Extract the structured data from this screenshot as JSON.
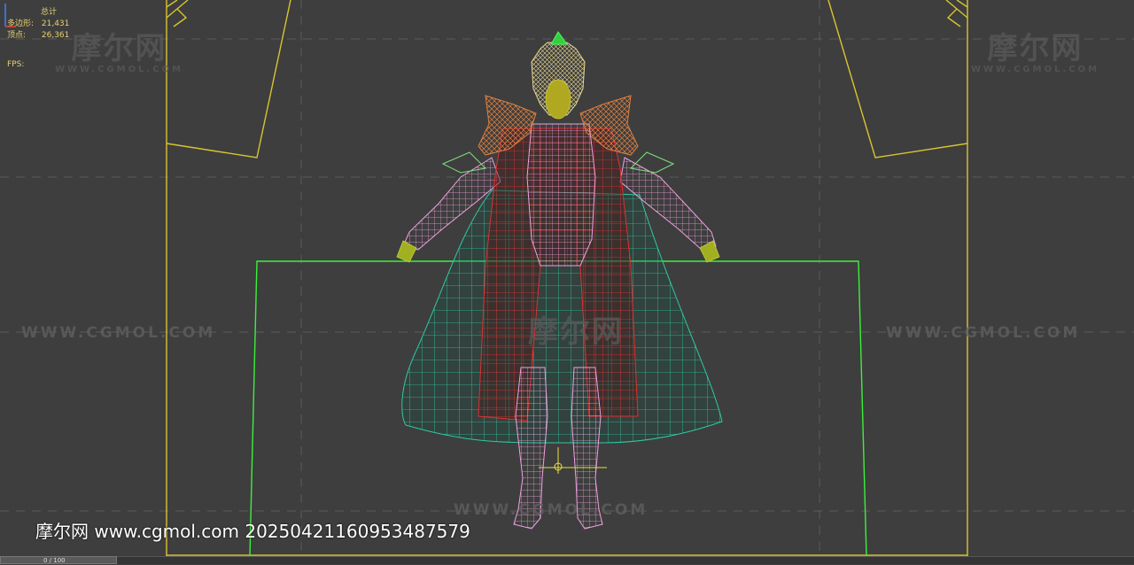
{
  "viewport": {
    "background_color": "#3e3e3e",
    "frame_color": "#d9c430",
    "safe_frame_color": "#3cf03c"
  },
  "stats": {
    "title": "总计",
    "polygons_label": "多边形:",
    "polygons_value": "21,431",
    "vertices_label": "顶点:",
    "vertices_value": "26,361",
    "fps_label": "FPS:"
  },
  "watermarks": {
    "logo_text": "摩尔网",
    "logo_subtext": "WWW.CGMOL.COM",
    "url_text": "WWW.CGMOL.COM"
  },
  "caption": "摩尔网 www.cgmol.com 20250421160953487579",
  "timeline": {
    "frame_label": "0 / 100"
  },
  "wireframe_colors": {
    "helmet": "#e8d890",
    "crest": "#30d040",
    "face": "#b0a820",
    "shoulders": "#e08040",
    "body": "#f0a0e0",
    "robe": "#e03030",
    "cape": "#30c8a0",
    "hands": "#a0b020"
  }
}
